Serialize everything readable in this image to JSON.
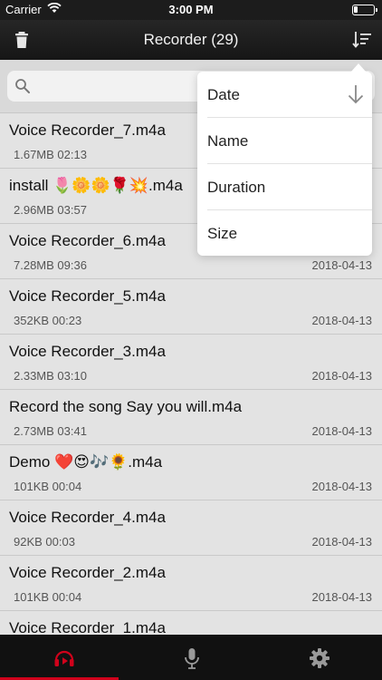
{
  "status_bar": {
    "carrier": "Carrier",
    "time": "3:00 PM",
    "wifi_icon": "wifi-icon",
    "battery_icon": "battery-icon"
  },
  "nav": {
    "title": "Recorder (29)",
    "left_icon": "trash-icon",
    "right_icon": "sort-icon"
  },
  "search": {
    "placeholder": "",
    "icon": "search-icon"
  },
  "sort_menu": {
    "items": [
      {
        "label": "Date",
        "selected": true,
        "indicator": "arrow-down-icon"
      },
      {
        "label": "Name",
        "selected": false
      },
      {
        "label": "Duration",
        "selected": false
      },
      {
        "label": "Size",
        "selected": false
      }
    ]
  },
  "recordings": [
    {
      "name": "Voice Recorder_7.m4a",
      "meta": "1.67MB 02:13",
      "date": ""
    },
    {
      "name": "install 🌷🌼🌼🌹💥.m4a",
      "meta": "2.96MB 03:57",
      "date": ""
    },
    {
      "name": "Voice Recorder_6.m4a",
      "meta": "7.28MB 09:36",
      "date": "2018-04-13"
    },
    {
      "name": "Voice Recorder_5.m4a",
      "meta": "352KB 00:23",
      "date": "2018-04-13"
    },
    {
      "name": "Voice Recorder_3.m4a",
      "meta": "2.33MB 03:10",
      "date": "2018-04-13"
    },
    {
      "name": "Record the song Say you will.m4a",
      "meta": "2.73MB 03:41",
      "date": "2018-04-13"
    },
    {
      "name": "Demo ❤️😍🎶🌻.m4a",
      "meta": "101KB 00:04",
      "date": "2018-04-13"
    },
    {
      "name": "Voice Recorder_4.m4a",
      "meta": "92KB 00:03",
      "date": "2018-04-13"
    },
    {
      "name": "Voice Recorder_2.m4a",
      "meta": "101KB 00:04",
      "date": "2018-04-13"
    },
    {
      "name": "Voice Recorder_1.m4a",
      "meta": "",
      "date": ""
    }
  ],
  "tabs": [
    {
      "icon": "recordings-play-icon",
      "active": true
    },
    {
      "icon": "microphone-icon",
      "active": false
    },
    {
      "icon": "gear-icon",
      "active": false
    }
  ],
  "colors": {
    "accent": "#d0021b",
    "nav_bg": "#1e1e1e",
    "list_bg": "#e3e3e3"
  }
}
